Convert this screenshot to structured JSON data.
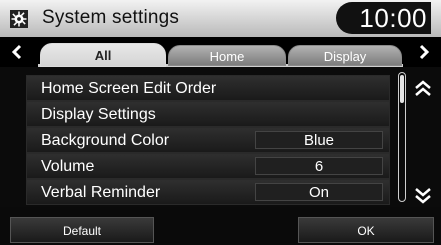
{
  "header": {
    "title": "System settings",
    "time": "10:00",
    "icon": "gear-icon"
  },
  "tabs": [
    {
      "label": "All",
      "active": true
    },
    {
      "label": "Home",
      "active": false
    },
    {
      "label": "Display",
      "active": false
    }
  ],
  "list": {
    "items": [
      {
        "label": "Home Screen Edit Order",
        "value": ""
      },
      {
        "label": "Display Settings",
        "value": ""
      },
      {
        "label": "Background Color",
        "value": "Blue"
      },
      {
        "label": "Volume",
        "value": "6"
      },
      {
        "label": "Verbal Reminder",
        "value": "On"
      }
    ]
  },
  "footer": {
    "default_label": "Default",
    "ok_label": "OK"
  }
}
